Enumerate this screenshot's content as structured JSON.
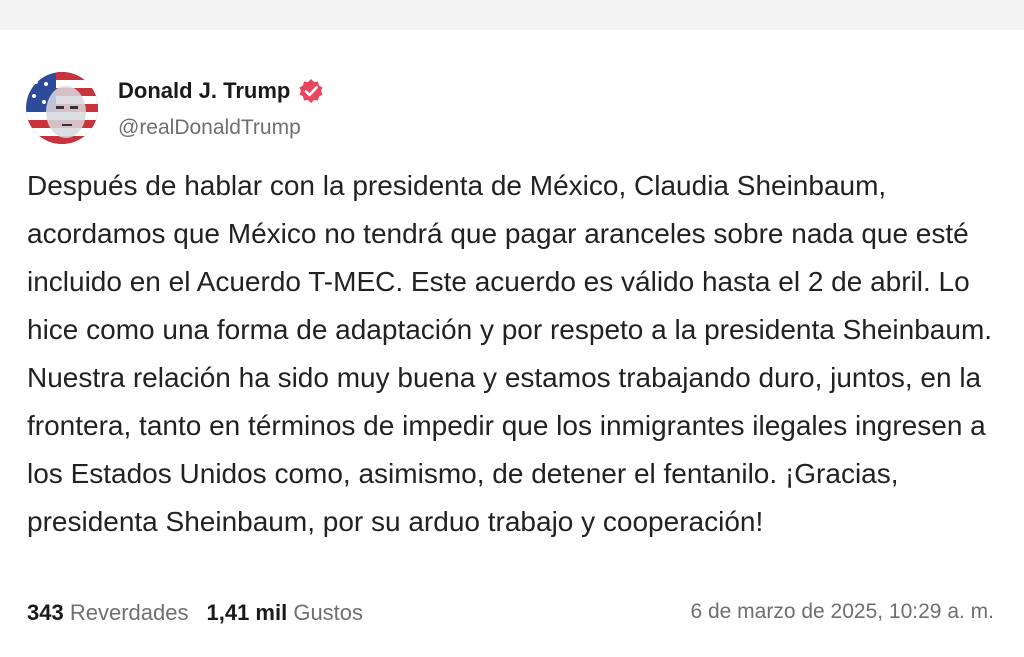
{
  "post": {
    "author": {
      "display_name": "Donald J. Trump",
      "handle": "@realDonaldTrump",
      "verified_icon": "verified-badge-icon",
      "badge_color": "#e8475f"
    },
    "text": "Después de hablar con la presidenta de México, Claudia Sheinbaum, acordamos que México no tendrá que pagar aranceles sobre nada que esté incluido en el Acuerdo T-MEC. Este acuerdo es válido hasta el 2 de abril. Lo hice como una forma de adaptación y por respeto a la presidenta Sheinbaum. Nuestra relación ha sido muy buena y estamos trabajando duro, juntos, en la frontera, tanto en términos de impedir que los inmigrantes ilegales ingresen a los Estados Unidos como, asimismo, de detener el fentanilo. ¡Gracias, presidenta Sheinbaum, por su arduo trabajo y cooperación!",
    "stats": {
      "reposts_count": "343",
      "reposts_label": "Reverdades",
      "likes_count": "1,41 mil",
      "likes_label": "Gustos"
    },
    "timestamp": "6 de marzo de 2025, 10:29 a. m."
  }
}
